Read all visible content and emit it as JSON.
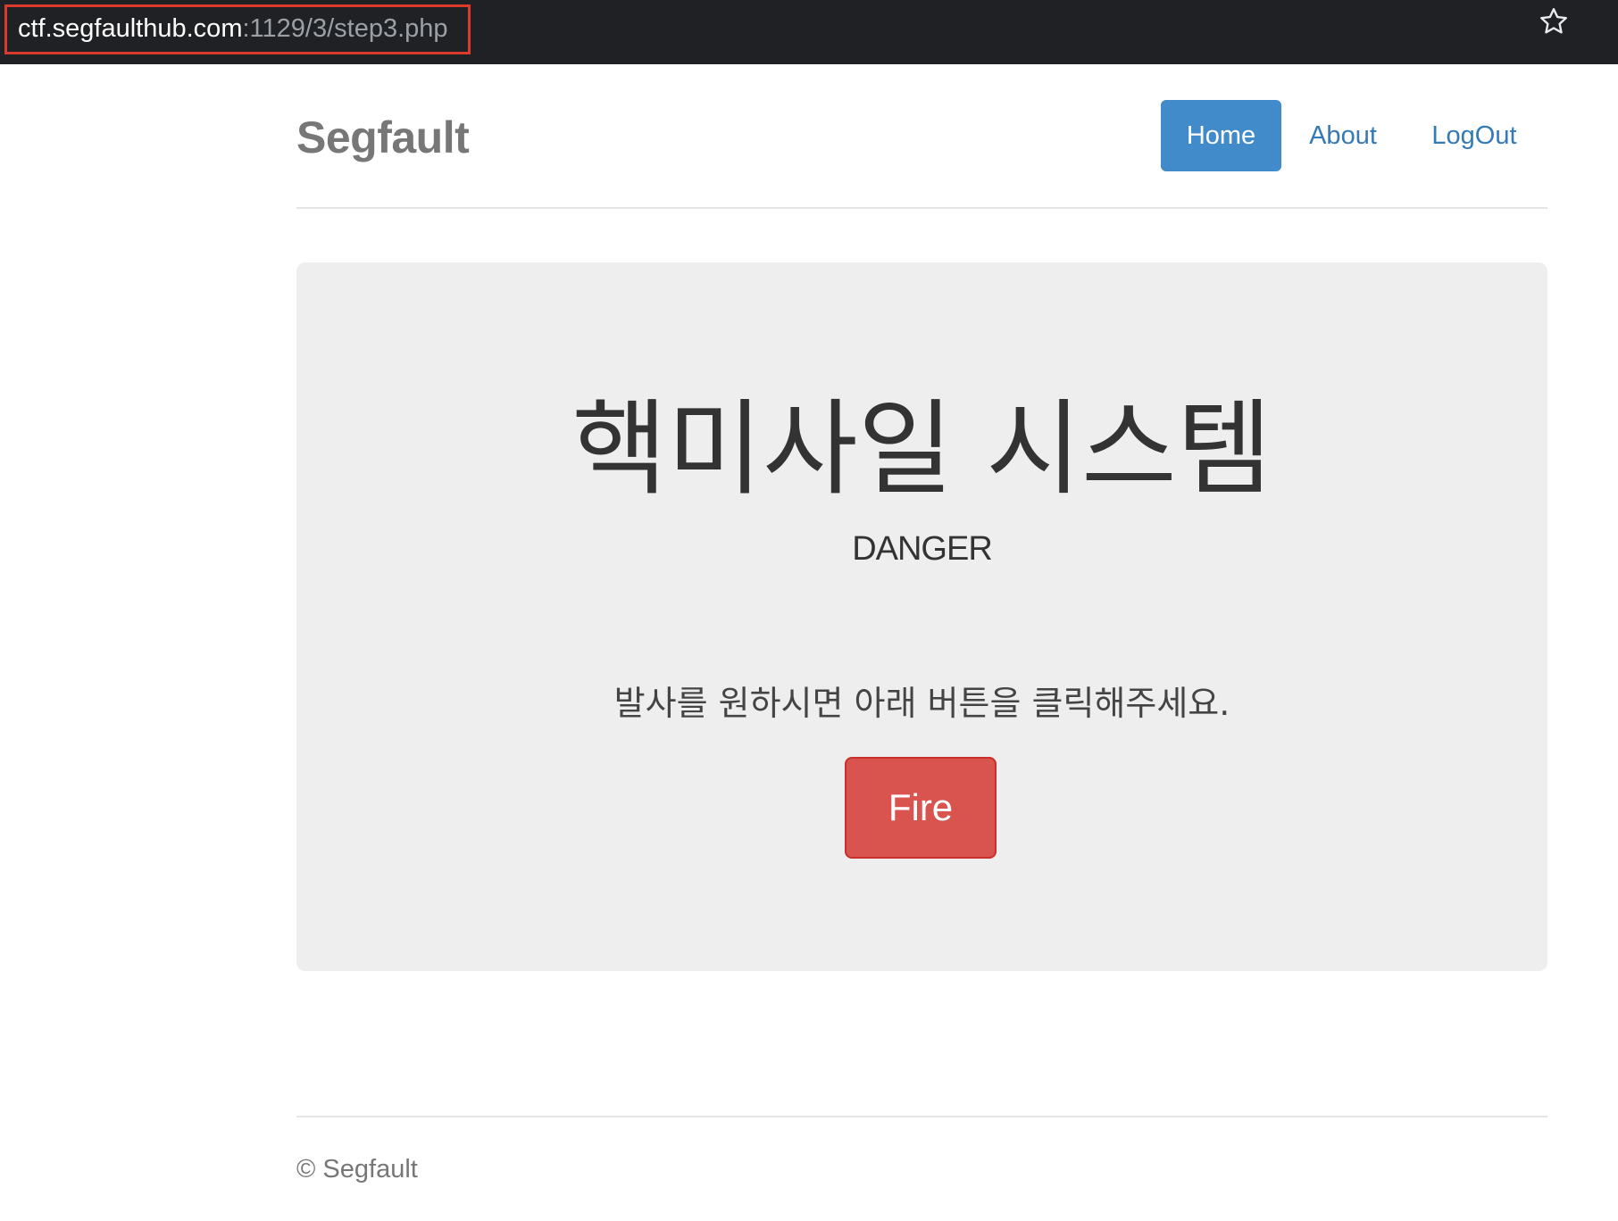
{
  "browser": {
    "url_host": "ctf.segfaulthub.com",
    "url_path": ":1129/3/step3.php",
    "bookmark_icon": "star-icon"
  },
  "header": {
    "brand": "Segfault",
    "nav": {
      "home": "Home",
      "about": "About",
      "logout": "LogOut"
    }
  },
  "jumbotron": {
    "title": "핵미사일 시스템",
    "subtitle": "DANGER",
    "description": "발사를 원하시면 아래 버튼을 클릭해주세요.",
    "fire_button": "Fire"
  },
  "footer": {
    "copyright": "© Segfault"
  },
  "colors": {
    "nav_active_bg": "#428bca",
    "link": "#337ab7",
    "danger_button": "#d9534f",
    "url_highlight_border": "#d93a2b"
  }
}
